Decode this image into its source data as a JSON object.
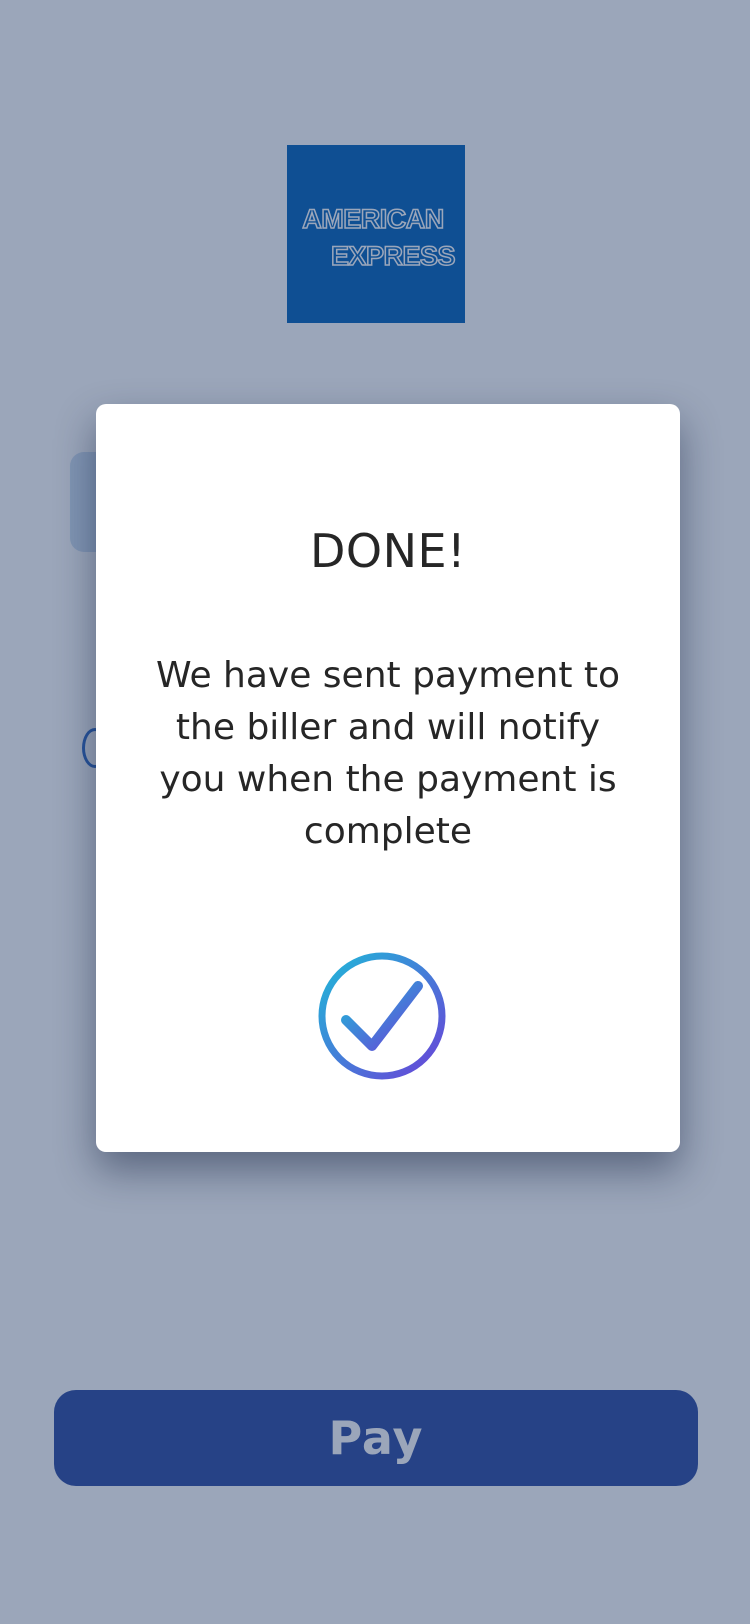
{
  "brand": {
    "logo_line1": "AMERICAN",
    "logo_line2": "EXPRESS",
    "color": "#0062b8"
  },
  "pay_button": {
    "label": "Pay",
    "color": "#1b2b6b"
  },
  "modal": {
    "title": "DONE!",
    "message": "We have sent payment to the biller and will notify you when the payment is complete",
    "icon": "check-circle-icon",
    "icon_gradient": [
      "#1fb8d8",
      "#6a42d8"
    ]
  },
  "overlay_color": "#9fb4c9"
}
